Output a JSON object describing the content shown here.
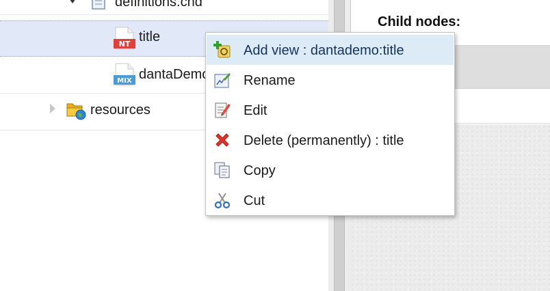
{
  "tree": {
    "nodes": [
      {
        "label": "definitions.cnd",
        "icon": "file-icon",
        "expanded": true
      },
      {
        "label": "title",
        "icon": "node-type-icon",
        "badge": "NT",
        "selected": true
      },
      {
        "label": "dantaDemo",
        "icon": "mixin-icon",
        "badge": "MIX"
      },
      {
        "label": "resources",
        "icon": "folder-globe-icon",
        "expanded": false
      }
    ]
  },
  "right_panel": {
    "child_nodes_title": "Child nodes:"
  },
  "context_menu": {
    "items": [
      {
        "label": "Add view : dantademo:title",
        "icon": "add-view-icon",
        "highlighted": true
      },
      {
        "label": "Rename",
        "icon": "rename-icon"
      },
      {
        "label": "Edit",
        "icon": "edit-icon"
      },
      {
        "label": "Delete (permanently) : title",
        "icon": "delete-icon"
      },
      {
        "label": "Copy",
        "icon": "copy-icon"
      },
      {
        "label": "Cut",
        "icon": "scissors-icon"
      }
    ]
  },
  "colors": {
    "selection": "#e1e8f7",
    "menu_highlight": "#ddebf6",
    "nt_badge": "#e0403a",
    "mix_badge": "#4a9bd6"
  }
}
